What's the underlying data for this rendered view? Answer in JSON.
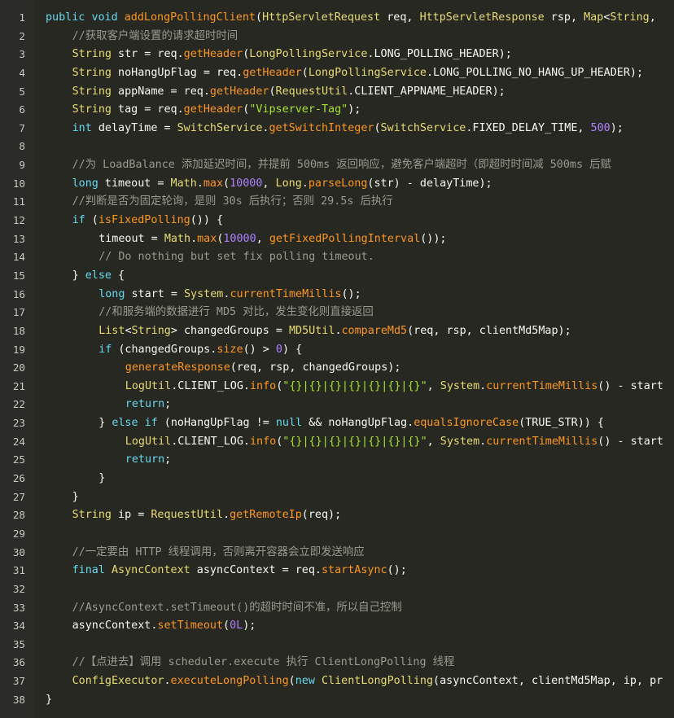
{
  "editor": {
    "theme_colors": {
      "background": "#272822",
      "gutter": "#2b2c27",
      "line_number": "#c9c9c3",
      "keyword": "#66d9ef",
      "type": "#e6db74",
      "function": "#fd971f",
      "comment": "#9a9a8e",
      "string": "#a6e22e",
      "number": "#ae81ff",
      "plain": "#f8f8f2"
    },
    "lines": [
      {
        "n": "1",
        "indent": 0,
        "tokens": [
          [
            "kw",
            "public"
          ],
          [
            "pl",
            " "
          ],
          [
            "kw",
            "void"
          ],
          [
            "pl",
            " "
          ],
          [
            "fn",
            "addLongPollingClient"
          ],
          [
            "pl",
            "("
          ],
          [
            "ty",
            "HttpServletRequest"
          ],
          [
            "pl",
            " req, "
          ],
          [
            "ty",
            "HttpServletResponse"
          ],
          [
            "pl",
            " rsp, "
          ],
          [
            "ty",
            "Map"
          ],
          [
            "pl",
            "<"
          ],
          [
            "ty",
            "String"
          ],
          [
            "pl",
            ","
          ]
        ]
      },
      {
        "n": "2",
        "indent": 1,
        "tokens": [
          [
            "cm",
            "//获取客户端设置的请求超时时间"
          ]
        ]
      },
      {
        "n": "3",
        "indent": 1,
        "tokens": [
          [
            "ty",
            "String"
          ],
          [
            "pl",
            " str = req."
          ],
          [
            "fn",
            "getHeader"
          ],
          [
            "pl",
            "("
          ],
          [
            "ty",
            "LongPollingService"
          ],
          [
            "pl",
            ".LONG_POLLING_HEADER);"
          ]
        ]
      },
      {
        "n": "4",
        "indent": 1,
        "tokens": [
          [
            "ty",
            "String"
          ],
          [
            "pl",
            " noHangUpFlag = req."
          ],
          [
            "fn",
            "getHeader"
          ],
          [
            "pl",
            "("
          ],
          [
            "ty",
            "LongPollingService"
          ],
          [
            "pl",
            ".LONG_POLLING_NO_HANG_UP_HEADER);"
          ]
        ]
      },
      {
        "n": "5",
        "indent": 1,
        "tokens": [
          [
            "ty",
            "String"
          ],
          [
            "pl",
            " appName = req."
          ],
          [
            "fn",
            "getHeader"
          ],
          [
            "pl",
            "("
          ],
          [
            "ty",
            "RequestUtil"
          ],
          [
            "pl",
            ".CLIENT_APPNAME_HEADER);"
          ]
        ]
      },
      {
        "n": "6",
        "indent": 1,
        "tokens": [
          [
            "ty",
            "String"
          ],
          [
            "pl",
            " tag = req."
          ],
          [
            "fn",
            "getHeader"
          ],
          [
            "pl",
            "("
          ],
          [
            "st",
            "\"Vipserver-Tag\""
          ],
          [
            "pl",
            ");"
          ]
        ]
      },
      {
        "n": "7",
        "indent": 1,
        "tokens": [
          [
            "kw",
            "int"
          ],
          [
            "pl",
            " delayTime = "
          ],
          [
            "ty",
            "SwitchService"
          ],
          [
            "pl",
            "."
          ],
          [
            "fn",
            "getSwitchInteger"
          ],
          [
            "pl",
            "("
          ],
          [
            "ty",
            "SwitchService"
          ],
          [
            "pl",
            ".FIXED_DELAY_TIME, "
          ],
          [
            "nu",
            "500"
          ],
          [
            "pl",
            ");"
          ]
        ]
      },
      {
        "n": "8",
        "indent": 0,
        "tokens": []
      },
      {
        "n": "9",
        "indent": 1,
        "tokens": [
          [
            "cm",
            "//为 LoadBalance 添加延迟时间，并提前 500ms 返回响应，避免客户端超时（即超时时间减 500ms 后赋"
          ]
        ]
      },
      {
        "n": "10",
        "indent": 1,
        "tokens": [
          [
            "kw",
            "long"
          ],
          [
            "pl",
            " timeout = "
          ],
          [
            "ty",
            "Math"
          ],
          [
            "pl",
            "."
          ],
          [
            "fn",
            "max"
          ],
          [
            "pl",
            "("
          ],
          [
            "nu",
            "10000"
          ],
          [
            "pl",
            ", "
          ],
          [
            "ty",
            "Long"
          ],
          [
            "pl",
            "."
          ],
          [
            "fn",
            "parseLong"
          ],
          [
            "pl",
            "(str) - delayTime);"
          ]
        ]
      },
      {
        "n": "11",
        "indent": 1,
        "tokens": [
          [
            "cm",
            "//判断是否为固定轮询，是则 30s 后执行；否则 29.5s 后执行"
          ]
        ]
      },
      {
        "n": "12",
        "indent": 1,
        "tokens": [
          [
            "kw",
            "if"
          ],
          [
            "pl",
            " ("
          ],
          [
            "fn",
            "isFixedPolling"
          ],
          [
            "pl",
            "()) {"
          ]
        ]
      },
      {
        "n": "13",
        "indent": 2,
        "tokens": [
          [
            "pl",
            "timeout = "
          ],
          [
            "ty",
            "Math"
          ],
          [
            "pl",
            "."
          ],
          [
            "fn",
            "max"
          ],
          [
            "pl",
            "("
          ],
          [
            "nu",
            "10000"
          ],
          [
            "pl",
            ", "
          ],
          [
            "fn",
            "getFixedPollingInterval"
          ],
          [
            "pl",
            "());"
          ]
        ]
      },
      {
        "n": "14",
        "indent": 2,
        "tokens": [
          [
            "cm",
            "// Do nothing but set fix polling timeout."
          ]
        ]
      },
      {
        "n": "15",
        "indent": 1,
        "tokens": [
          [
            "pl",
            "} "
          ],
          [
            "kw",
            "else"
          ],
          [
            "pl",
            " {"
          ]
        ]
      },
      {
        "n": "16",
        "indent": 2,
        "tokens": [
          [
            "kw",
            "long"
          ],
          [
            "pl",
            " start = "
          ],
          [
            "ty",
            "System"
          ],
          [
            "pl",
            "."
          ],
          [
            "fn",
            "currentTimeMillis"
          ],
          [
            "pl",
            "();"
          ]
        ]
      },
      {
        "n": "17",
        "indent": 2,
        "tokens": [
          [
            "cm",
            "//和服务端的数据进行 MD5 对比，发生变化则直接返回"
          ]
        ]
      },
      {
        "n": "18",
        "indent": 2,
        "tokens": [
          [
            "ty",
            "List"
          ],
          [
            "pl",
            "<"
          ],
          [
            "ty",
            "String"
          ],
          [
            "pl",
            "> changedGroups = "
          ],
          [
            "ty",
            "MD5Util"
          ],
          [
            "pl",
            "."
          ],
          [
            "fn",
            "compareMd5"
          ],
          [
            "pl",
            "(req, rsp, clientMd5Map);"
          ]
        ]
      },
      {
        "n": "19",
        "indent": 2,
        "tokens": [
          [
            "kw",
            "if"
          ],
          [
            "pl",
            " (changedGroups."
          ],
          [
            "fn",
            "size"
          ],
          [
            "pl",
            "() > "
          ],
          [
            "nu",
            "0"
          ],
          [
            "pl",
            ") {"
          ]
        ]
      },
      {
        "n": "20",
        "indent": 3,
        "tokens": [
          [
            "fn",
            "generateResponse"
          ],
          [
            "pl",
            "(req, rsp, changedGroups);"
          ]
        ]
      },
      {
        "n": "21",
        "indent": 3,
        "tokens": [
          [
            "ty",
            "LogUtil"
          ],
          [
            "pl",
            ".CLIENT_LOG."
          ],
          [
            "fn",
            "info"
          ],
          [
            "pl",
            "("
          ],
          [
            "st",
            "\"{}|{}|{}|{}|{}|{}|{}\""
          ],
          [
            "pl",
            ", "
          ],
          [
            "ty",
            "System"
          ],
          [
            "pl",
            "."
          ],
          [
            "fn",
            "currentTimeMillis"
          ],
          [
            "pl",
            "() - start"
          ]
        ]
      },
      {
        "n": "22",
        "indent": 3,
        "tokens": [
          [
            "kw",
            "return"
          ],
          [
            "pl",
            ";"
          ]
        ]
      },
      {
        "n": "23",
        "indent": 2,
        "tokens": [
          [
            "pl",
            "} "
          ],
          [
            "kw",
            "else if"
          ],
          [
            "pl",
            " (noHangUpFlag != "
          ],
          [
            "kw",
            "null"
          ],
          [
            "pl",
            " && noHangUpFlag."
          ],
          [
            "fn",
            "equalsIgnoreCase"
          ],
          [
            "pl",
            "(TRUE_STR)) {"
          ]
        ]
      },
      {
        "n": "24",
        "indent": 3,
        "tokens": [
          [
            "ty",
            "LogUtil"
          ],
          [
            "pl",
            ".CLIENT_LOG."
          ],
          [
            "fn",
            "info"
          ],
          [
            "pl",
            "("
          ],
          [
            "st",
            "\"{}|{}|{}|{}|{}|{}|{}\""
          ],
          [
            "pl",
            ", "
          ],
          [
            "ty",
            "System"
          ],
          [
            "pl",
            "."
          ],
          [
            "fn",
            "currentTimeMillis"
          ],
          [
            "pl",
            "() - start"
          ]
        ]
      },
      {
        "n": "25",
        "indent": 3,
        "tokens": [
          [
            "kw",
            "return"
          ],
          [
            "pl",
            ";"
          ]
        ]
      },
      {
        "n": "26",
        "indent": 2,
        "tokens": [
          [
            "pl",
            "}"
          ]
        ]
      },
      {
        "n": "27",
        "indent": 1,
        "tokens": [
          [
            "pl",
            "}"
          ]
        ]
      },
      {
        "n": "28",
        "indent": 1,
        "tokens": [
          [
            "ty",
            "String"
          ],
          [
            "pl",
            " ip = "
          ],
          [
            "ty",
            "RequestUtil"
          ],
          [
            "pl",
            "."
          ],
          [
            "fn",
            "getRemoteIp"
          ],
          [
            "pl",
            "(req);"
          ]
        ]
      },
      {
        "n": "29",
        "indent": 0,
        "tokens": []
      },
      {
        "n": "30",
        "indent": 1,
        "tokens": [
          [
            "cm",
            "//一定要由 HTTP 线程调用，否则离开容器会立即发送响应"
          ]
        ]
      },
      {
        "n": "31",
        "indent": 1,
        "tokens": [
          [
            "kw",
            "final"
          ],
          [
            "pl",
            " "
          ],
          [
            "ty",
            "AsyncContext"
          ],
          [
            "pl",
            " asyncContext = req."
          ],
          [
            "fn",
            "startAsync"
          ],
          [
            "pl",
            "();"
          ]
        ]
      },
      {
        "n": "32",
        "indent": 0,
        "tokens": []
      },
      {
        "n": "33",
        "indent": 1,
        "tokens": [
          [
            "cm",
            "//AsyncContext.setTimeout()的超时时间不准，所以自己控制"
          ]
        ]
      },
      {
        "n": "34",
        "indent": 1,
        "tokens": [
          [
            "pl",
            "asyncContext."
          ],
          [
            "fn",
            "setTimeout"
          ],
          [
            "pl",
            "("
          ],
          [
            "nu",
            "0L"
          ],
          [
            "pl",
            ");"
          ]
        ]
      },
      {
        "n": "35",
        "indent": 0,
        "tokens": []
      },
      {
        "n": "36",
        "indent": 1,
        "tokens": [
          [
            "cm",
            "//【点进去】调用 scheduler.execute 执行 ClientLongPolling 线程"
          ]
        ]
      },
      {
        "n": "37",
        "indent": 1,
        "tokens": [
          [
            "ty",
            "ConfigExecutor"
          ],
          [
            "pl",
            "."
          ],
          [
            "fn",
            "executeLongPolling"
          ],
          [
            "pl",
            "("
          ],
          [
            "kw",
            "new"
          ],
          [
            "pl",
            " "
          ],
          [
            "ty",
            "ClientLongPolling"
          ],
          [
            "pl",
            "(asyncContext, clientMd5Map, ip, pr"
          ]
        ]
      },
      {
        "n": "38",
        "indent": 0,
        "tokens": [
          [
            "pl",
            "}"
          ]
        ]
      }
    ]
  }
}
